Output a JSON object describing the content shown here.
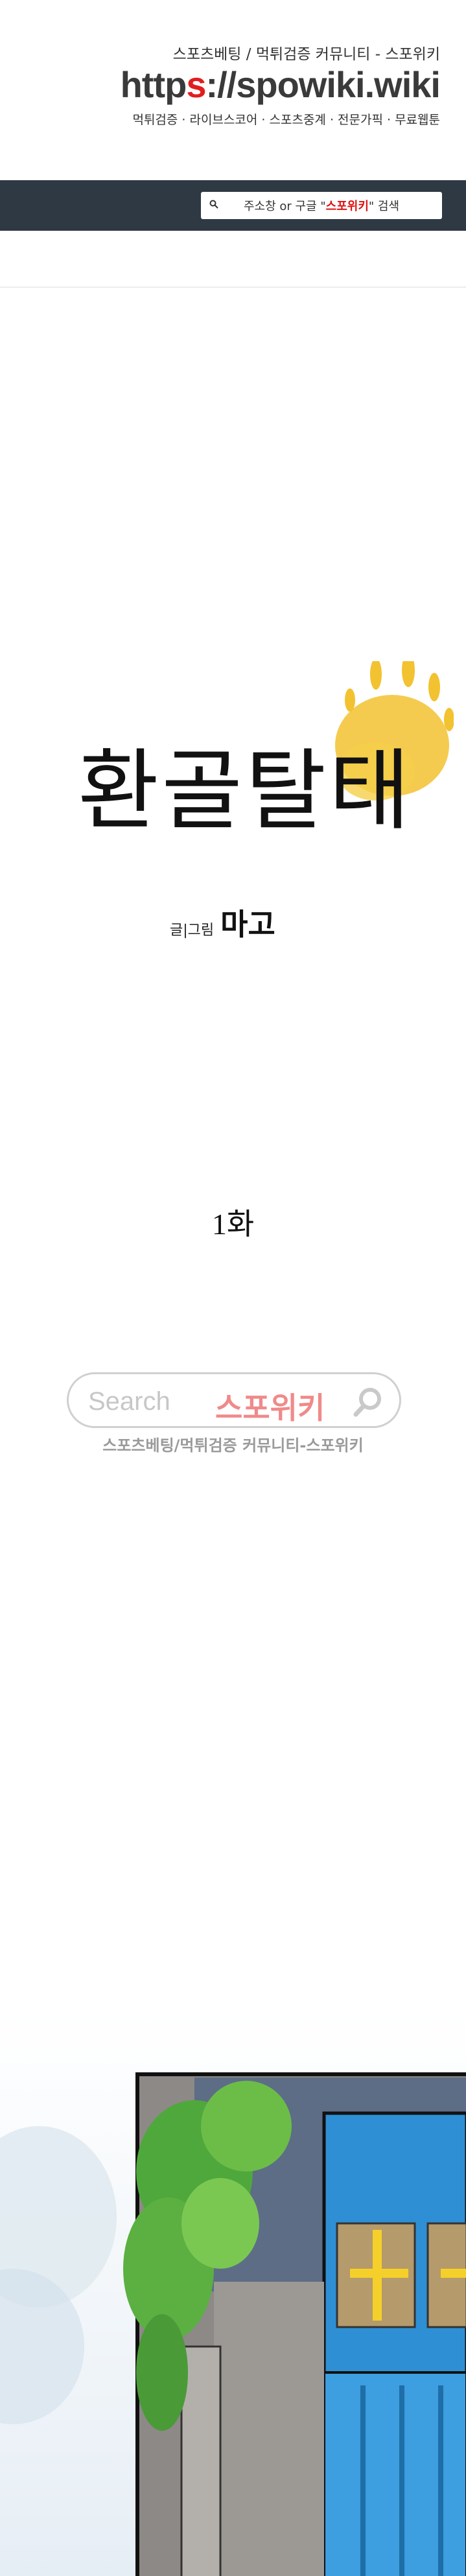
{
  "header": {
    "tagline": "스포츠베팅 / 먹튀검증 커뮤니티 - 스포위키",
    "url_prefix": "http",
    "url_red": "s",
    "url_suffix": "://spowiki.wiki",
    "links": "먹튀검증 · 라이브스코어 · 스포츠중계 · 전문가픽 · 무료웹툰"
  },
  "search": {
    "before": "주소창 or 구글 \"",
    "highlight": "스포위키",
    "after": "\" 검색"
  },
  "comic": {
    "title": "환골탈태",
    "credit_label": "글|그림",
    "author": "마고",
    "episode": "1화"
  },
  "watermark": {
    "placeholder": "Search",
    "brand": "스포위키",
    "caption": "스포츠베팅/먹튀검증 커뮤니티-스포위키"
  },
  "colors": {
    "navbar": "#2e3944",
    "accent_red": "#e21e1e",
    "title_splash": "#f2c230"
  }
}
